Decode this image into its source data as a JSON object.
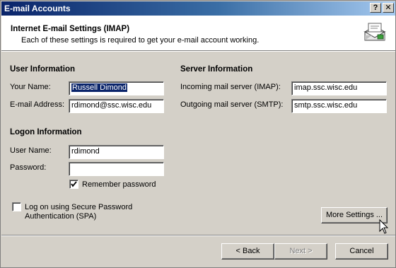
{
  "window": {
    "title": "E-mail Accounts",
    "help_glyph": "?",
    "close_glyph": "✕"
  },
  "header": {
    "title": "Internet E-mail Settings (IMAP)",
    "subtitle": "Each of these settings is required to get your e-mail account working."
  },
  "user_info": {
    "heading": "User Information",
    "name_label": "Your Name:",
    "name_value": "Russell Dimond",
    "email_label": "E-mail Address:",
    "email_value": "rdimond@ssc.wisc.edu"
  },
  "server_info": {
    "heading": "Server Information",
    "incoming_label": "Incoming mail server (IMAP):",
    "incoming_value": "imap.ssc.wisc.edu",
    "outgoing_label": "Outgoing mail server (SMTP):",
    "outgoing_value": "smtp.ssc.wisc.edu"
  },
  "logon_info": {
    "heading": "Logon Information",
    "username_label": "User Name:",
    "username_value": "rdimond",
    "password_label": "Password:",
    "password_value": "",
    "remember_label": "Remember password",
    "remember_checked": true
  },
  "spa": {
    "label_line1": "Log on using Secure Password",
    "label_line2": "Authentication (SPA)",
    "checked": false
  },
  "buttons": {
    "more_settings": "More Settings ...",
    "back": "< Back",
    "next": "Next >",
    "cancel": "Cancel"
  }
}
